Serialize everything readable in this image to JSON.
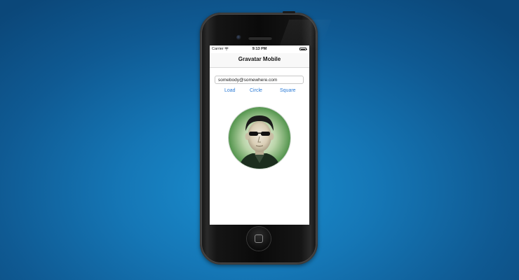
{
  "status_bar": {
    "carrier": "Carrier",
    "time": "9:13 PM",
    "wifi_icon": "wifi-icon",
    "battery_icon": "battery-icon"
  },
  "nav": {
    "title": "Gravatar Mobile"
  },
  "email_field": {
    "value": "somebody@somewhere.com"
  },
  "buttons": {
    "load": "Load",
    "circle": "Circle",
    "square": "Square"
  },
  "avatar": {
    "icon": "avatar-image"
  },
  "colors": {
    "accent": "#2b7bd6",
    "background": "#1577b6"
  }
}
